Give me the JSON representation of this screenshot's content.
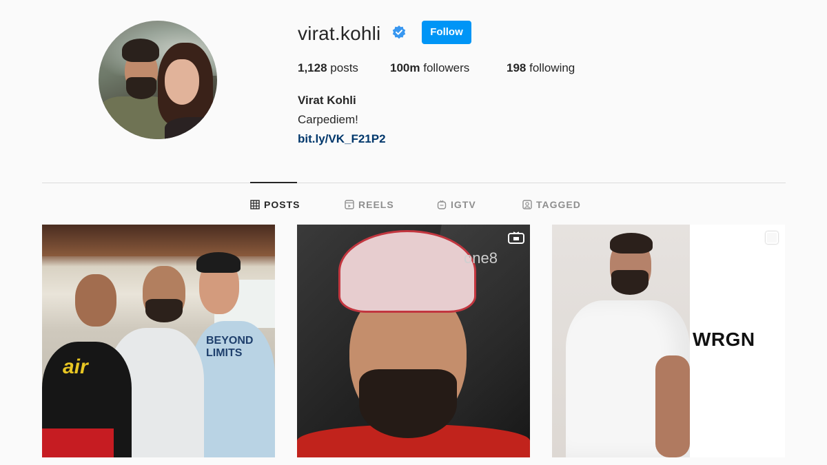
{
  "profile": {
    "username": "virat.kohli",
    "follow_label": "Follow",
    "stats": {
      "posts_count": "1,128",
      "posts_label": "posts",
      "followers_count": "100m",
      "followers_label": "followers",
      "following_count": "198",
      "following_label": "following"
    },
    "full_name": "Virat Kohli",
    "bio": "Carpediem!",
    "link": "bit.ly/VK_F21P2"
  },
  "tabs": [
    {
      "label": "POSTS",
      "icon": "grid-icon",
      "active": true
    },
    {
      "label": "REELS",
      "icon": "reels-icon",
      "active": false
    },
    {
      "label": "IGTV",
      "icon": "igtv-icon",
      "active": false
    },
    {
      "label": "TAGGED",
      "icon": "tagged-icon",
      "active": false
    }
  ],
  "posts": [
    {
      "overlay_text": [
        "air",
        "BEYOND LIMITS"
      ],
      "badge": ""
    },
    {
      "overlay_text": [
        "one8"
      ],
      "badge": "igtv-icon"
    },
    {
      "overlay_text": [
        "WRGN"
      ],
      "badge": "multi-post-icon"
    }
  ],
  "colors": {
    "accent": "#0095f6",
    "link": "#00376b",
    "verified": "#3897f0",
    "text": "#262626",
    "muted": "#8e8e8e",
    "background": "#fafafa"
  }
}
